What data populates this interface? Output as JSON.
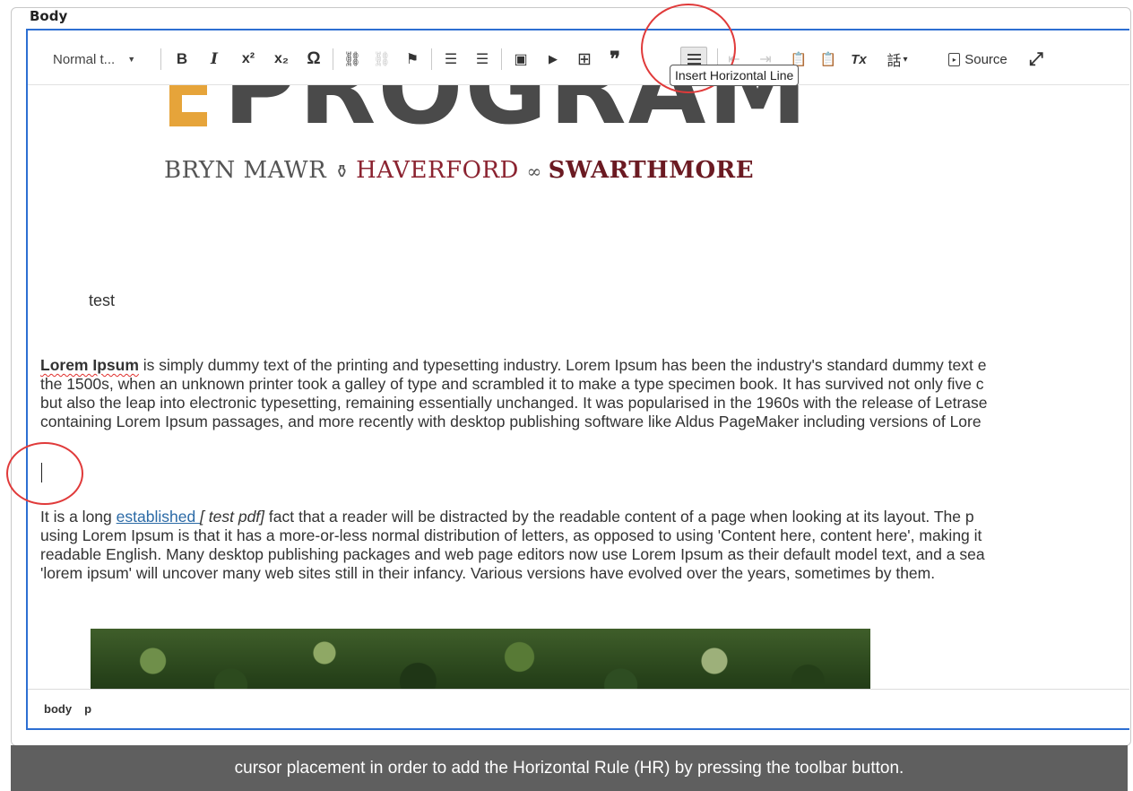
{
  "field": {
    "label": "Body"
  },
  "toolbar": {
    "format_select": "Normal t...",
    "bold": "B",
    "italic": "I",
    "superscript": "x²",
    "subscript": "x₂",
    "special_char": "Ω",
    "link": "⛓",
    "unlink": "⛓",
    "anchor": "⚑",
    "bulleted_list": "☰",
    "numbered_list": "☰",
    "image": "▣",
    "media": "▶",
    "table": "⊞",
    "blockquote": "❞",
    "outdent": "⇤",
    "indent": "⇥",
    "paste_text": "📋",
    "paste_word": "📋",
    "remove_format": "Tx",
    "language": "話",
    "source_label": "Source",
    "maximize": "⤢"
  },
  "tooltip": "Insert Horizontal Line",
  "content": {
    "logo_main": "PROGRAM",
    "logo_sub_bm": "BRYN MAWR",
    "logo_sub_hv": "HAVERFORD",
    "logo_sub_sw": "SWARTHMORE",
    "test": "test",
    "p1": {
      "bold": "Lorem Ipsum",
      "line1": " is simply dummy text of the printing and typesetting industry. Lorem Ipsum has been the industry's standard dummy text e",
      "line2": "the 1500s, when an unknown printer took a galley of type and scrambled it to make a type specimen book. It has survived not only five c",
      "line3": "but also the leap into electronic typesetting, remaining essentially unchanged. It was popularised in the 1960s with the release of Letrase",
      "line4": "containing Lorem Ipsum passages, and more recently with desktop publishing software like Aldus PageMaker including versions of Lore"
    },
    "p2": {
      "line1_start": " It is a long ",
      "link": "established ",
      "link_note": "[ test pdf]",
      "line1_end": " fact that a reader will be distracted by the readable content of a page when looking at its layout. The p",
      "line2": "using Lorem Ipsum is that it has a more-or-less normal distribution of letters, as opposed to using 'Content here, content here', making it",
      "line3": "readable English. Many desktop publishing packages and web page editors now use Lorem Ipsum as their default model text, and a sea",
      "line4": "'lorem ipsum' will uncover many web sites still in their infancy. Various versions have evolved over the years, sometimes by them."
    }
  },
  "path_bar": {
    "body": "body",
    "p": "p"
  },
  "caption": "cursor placement in order to add the Horizontal Rule (HR) by pressing the toolbar button."
}
